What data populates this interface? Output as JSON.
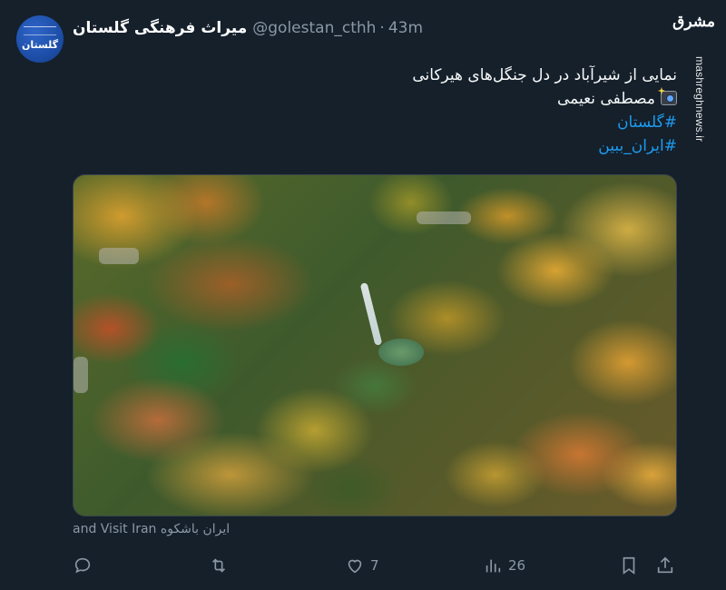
{
  "tweet": {
    "display_name": "میراث فرهنگی گلستان",
    "handle": "@golestan_cthh",
    "separator": "·",
    "time": "43m",
    "body_line1": "نمایی از شیرآباد در دل جنگل‌های هیرکانی",
    "photographer": "مصطفی نعیمی",
    "hashtag1": "#گلستان",
    "hashtag2": "#ایران_ببین",
    "photo_caption": "ایران باشکوه and Visit Iran"
  },
  "avatar": {
    "text": "گلستان"
  },
  "watermark": {
    "logo": "مشرق",
    "site": "mashreghnews.ir"
  },
  "actions": {
    "reply_count": "",
    "retweet_count": "",
    "like_count": "7",
    "views_count": "26"
  },
  "icons": {
    "reply": "reply-icon",
    "retweet": "retweet-icon",
    "like": "heart-icon",
    "views": "views-icon",
    "bookmark": "bookmark-icon",
    "share": "share-icon"
  },
  "colors": {
    "background": "#15202b",
    "accent": "#1d9bf0",
    "muted": "#8b98a5",
    "text": "#f7f9f9"
  }
}
